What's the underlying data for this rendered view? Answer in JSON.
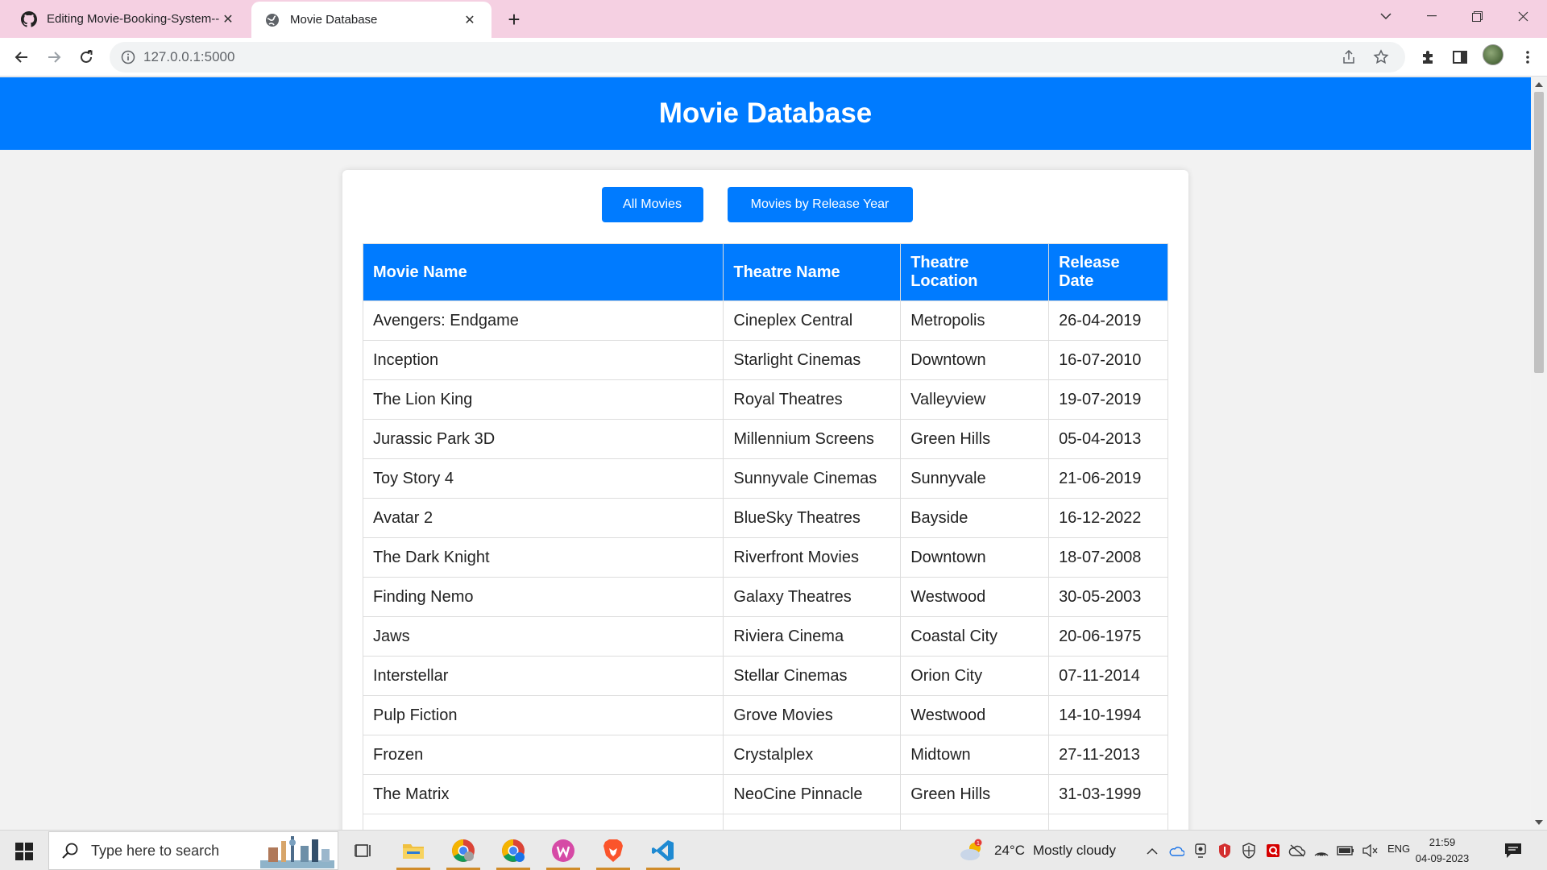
{
  "browser": {
    "tabs": [
      {
        "title": "Editing Movie-Booking-System--",
        "favicon": "github-icon",
        "active": false
      },
      {
        "title": "Movie Database",
        "favicon": "globe-icon",
        "active": true
      }
    ],
    "url": "127.0.0.1:5000"
  },
  "page": {
    "header_title": "Movie Database",
    "buttons": {
      "all_movies": "All Movies",
      "by_year": "Movies by Release Year"
    },
    "table": {
      "columns": [
        "Movie Name",
        "Theatre Name",
        "Theatre Location",
        "Release Date"
      ],
      "rows": [
        [
          "Avengers: Endgame",
          "Cineplex Central",
          "Metropolis",
          "26-04-2019"
        ],
        [
          "Inception",
          "Starlight Cinemas",
          "Downtown",
          "16-07-2010"
        ],
        [
          "The Lion King",
          "Royal Theatres",
          "Valleyview",
          "19-07-2019"
        ],
        [
          "Jurassic Park 3D",
          "Millennium Screens",
          "Green Hills",
          "05-04-2013"
        ],
        [
          "Toy Story 4",
          "Sunnyvale Cinemas",
          "Sunnyvale",
          "21-06-2019"
        ],
        [
          "Avatar 2",
          "BlueSky Theatres",
          "Bayside",
          "16-12-2022"
        ],
        [
          "The Dark Knight",
          "Riverfront Movies",
          "Downtown",
          "18-07-2008"
        ],
        [
          "Finding Nemo",
          "Galaxy Theatres",
          "Westwood",
          "30-05-2003"
        ],
        [
          "Jaws",
          "Riviera Cinema",
          "Coastal City",
          "20-06-1975"
        ],
        [
          "Interstellar",
          "Stellar Cinemas",
          "Orion City",
          "07-11-2014"
        ],
        [
          "Pulp Fiction",
          "Grove Movies",
          "Westwood",
          "14-10-1994"
        ],
        [
          "Frozen",
          "Crystalplex",
          "Midtown",
          "27-11-2013"
        ],
        [
          "The Matrix",
          "NeoCine Pinnacle",
          "Green Hills",
          "31-03-1999"
        ],
        [
          "",
          "",
          "",
          ""
        ]
      ]
    },
    "colors": {
      "accent": "#007bff",
      "background": "#f2f2f2",
      "tabstrip": "#f5d0e2"
    }
  },
  "taskbar": {
    "search_placeholder": "Type here to search",
    "weather": {
      "temp": "24°C",
      "condition": "Mostly cloudy"
    },
    "language": "ENG",
    "time": "21:59",
    "date": "04-09-2023"
  }
}
